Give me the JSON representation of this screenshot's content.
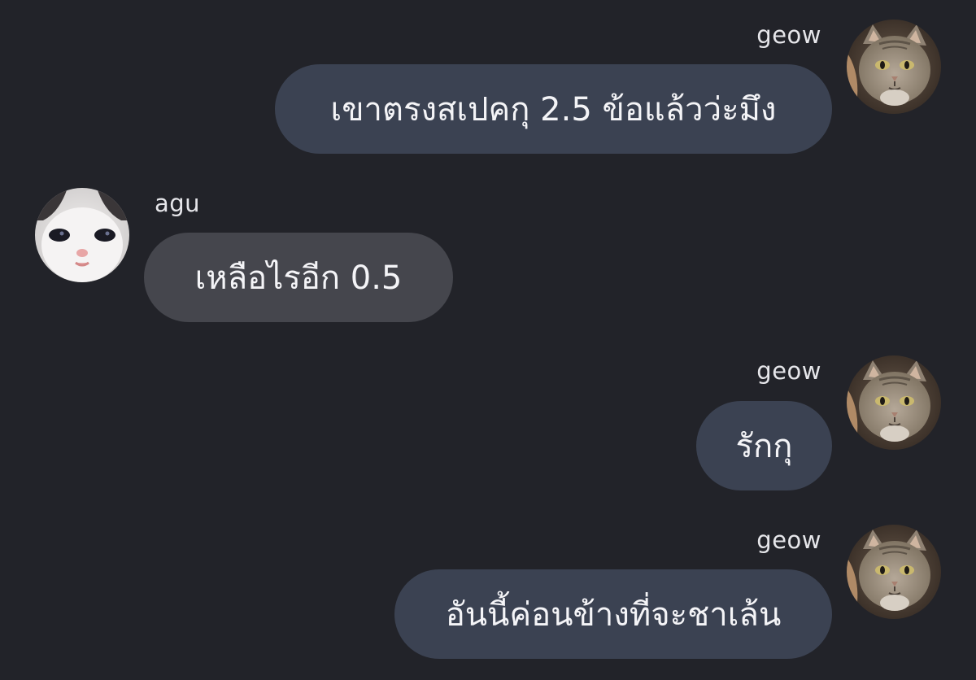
{
  "messages": [
    {
      "sender": "geow",
      "side": "right",
      "text": "เขาตรงสเปคกุ 2.5 ข้อแล้วว่ะมึง",
      "avatar_icon": "tabby-cat-avatar-icon"
    },
    {
      "sender": "agu",
      "side": "left",
      "text": "เหลือไรอีก 0.5",
      "avatar_icon": "white-kitten-avatar-icon"
    },
    {
      "sender": "geow",
      "side": "right",
      "text": "รักกุ",
      "avatar_icon": "tabby-cat-avatar-icon"
    },
    {
      "sender": "geow",
      "side": "right",
      "text": "อันนี้ค่อนข้างที่จะชาเล้น",
      "avatar_icon": "tabby-cat-avatar-icon"
    }
  ],
  "colors": {
    "background": "#222329",
    "my_bubble": "#3b4252",
    "their_bubble": "#45464d",
    "text": "#f4f4f7"
  }
}
